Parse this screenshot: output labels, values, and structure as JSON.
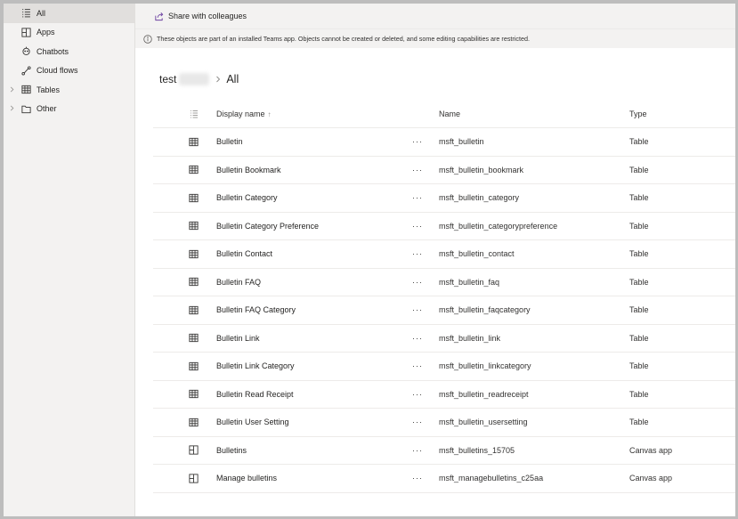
{
  "sidebar": {
    "items": [
      {
        "label": "All",
        "icon": "list-icon",
        "active": true,
        "expandable": false
      },
      {
        "label": "Apps",
        "icon": "apps-icon",
        "active": false,
        "expandable": false
      },
      {
        "label": "Chatbots",
        "icon": "chatbot-icon",
        "active": false,
        "expandable": false
      },
      {
        "label": "Cloud flows",
        "icon": "flow-icon",
        "active": false,
        "expandable": false
      },
      {
        "label": "Tables",
        "icon": "table-icon",
        "active": false,
        "expandable": true
      },
      {
        "label": "Other",
        "icon": "folder-icon",
        "active": false,
        "expandable": true
      }
    ]
  },
  "toolbar": {
    "share_label": "Share with colleagues"
  },
  "info": {
    "message": "These objects are part of an installed Teams app. Objects cannot be created or deleted, and some editing capabilities are restricted."
  },
  "breadcrumb": {
    "first": "test",
    "current": "All"
  },
  "table": {
    "columns": {
      "display_name": "Display name",
      "sort_indicator": "↑",
      "name": "Name",
      "type": "Type"
    },
    "more_label": "···",
    "rows": [
      {
        "display_name": "Bulletin",
        "name": "msft_bulletin",
        "type": "Table",
        "icon": "table-icon"
      },
      {
        "display_name": "Bulletin Bookmark",
        "name": "msft_bulletin_bookmark",
        "type": "Table",
        "icon": "table-icon"
      },
      {
        "display_name": "Bulletin Category",
        "name": "msft_bulletin_category",
        "type": "Table",
        "icon": "table-icon"
      },
      {
        "display_name": "Bulletin Category Preference",
        "name": "msft_bulletin_categorypreference",
        "type": "Table",
        "icon": "table-icon"
      },
      {
        "display_name": "Bulletin Contact",
        "name": "msft_bulletin_contact",
        "type": "Table",
        "icon": "table-icon"
      },
      {
        "display_name": "Bulletin FAQ",
        "name": "msft_bulletin_faq",
        "type": "Table",
        "icon": "table-icon"
      },
      {
        "display_name": "Bulletin FAQ Category",
        "name": "msft_bulletin_faqcategory",
        "type": "Table",
        "icon": "table-icon"
      },
      {
        "display_name": "Bulletin Link",
        "name": "msft_bulletin_link",
        "type": "Table",
        "icon": "table-icon"
      },
      {
        "display_name": "Bulletin Link Category",
        "name": "msft_bulletin_linkcategory",
        "type": "Table",
        "icon": "table-icon"
      },
      {
        "display_name": "Bulletin Read Receipt",
        "name": "msft_bulletin_readreceipt",
        "type": "Table",
        "icon": "table-icon"
      },
      {
        "display_name": "Bulletin User Setting",
        "name": "msft_bulletin_usersetting",
        "type": "Table",
        "icon": "table-icon"
      },
      {
        "display_name": "Bulletins",
        "name": "msft_bulletins_15705",
        "type": "Canvas app",
        "icon": "canvas-app-icon"
      },
      {
        "display_name": "Manage bulletins",
        "name": "msft_managebulletins_c25aa",
        "type": "Canvas app",
        "icon": "canvas-app-icon"
      }
    ]
  },
  "colors": {
    "sidebar_bg": "#f3f2f1",
    "active_bg": "#e1dfdd",
    "share_icon": "#6b3fa0",
    "divider": "#edebe9"
  }
}
